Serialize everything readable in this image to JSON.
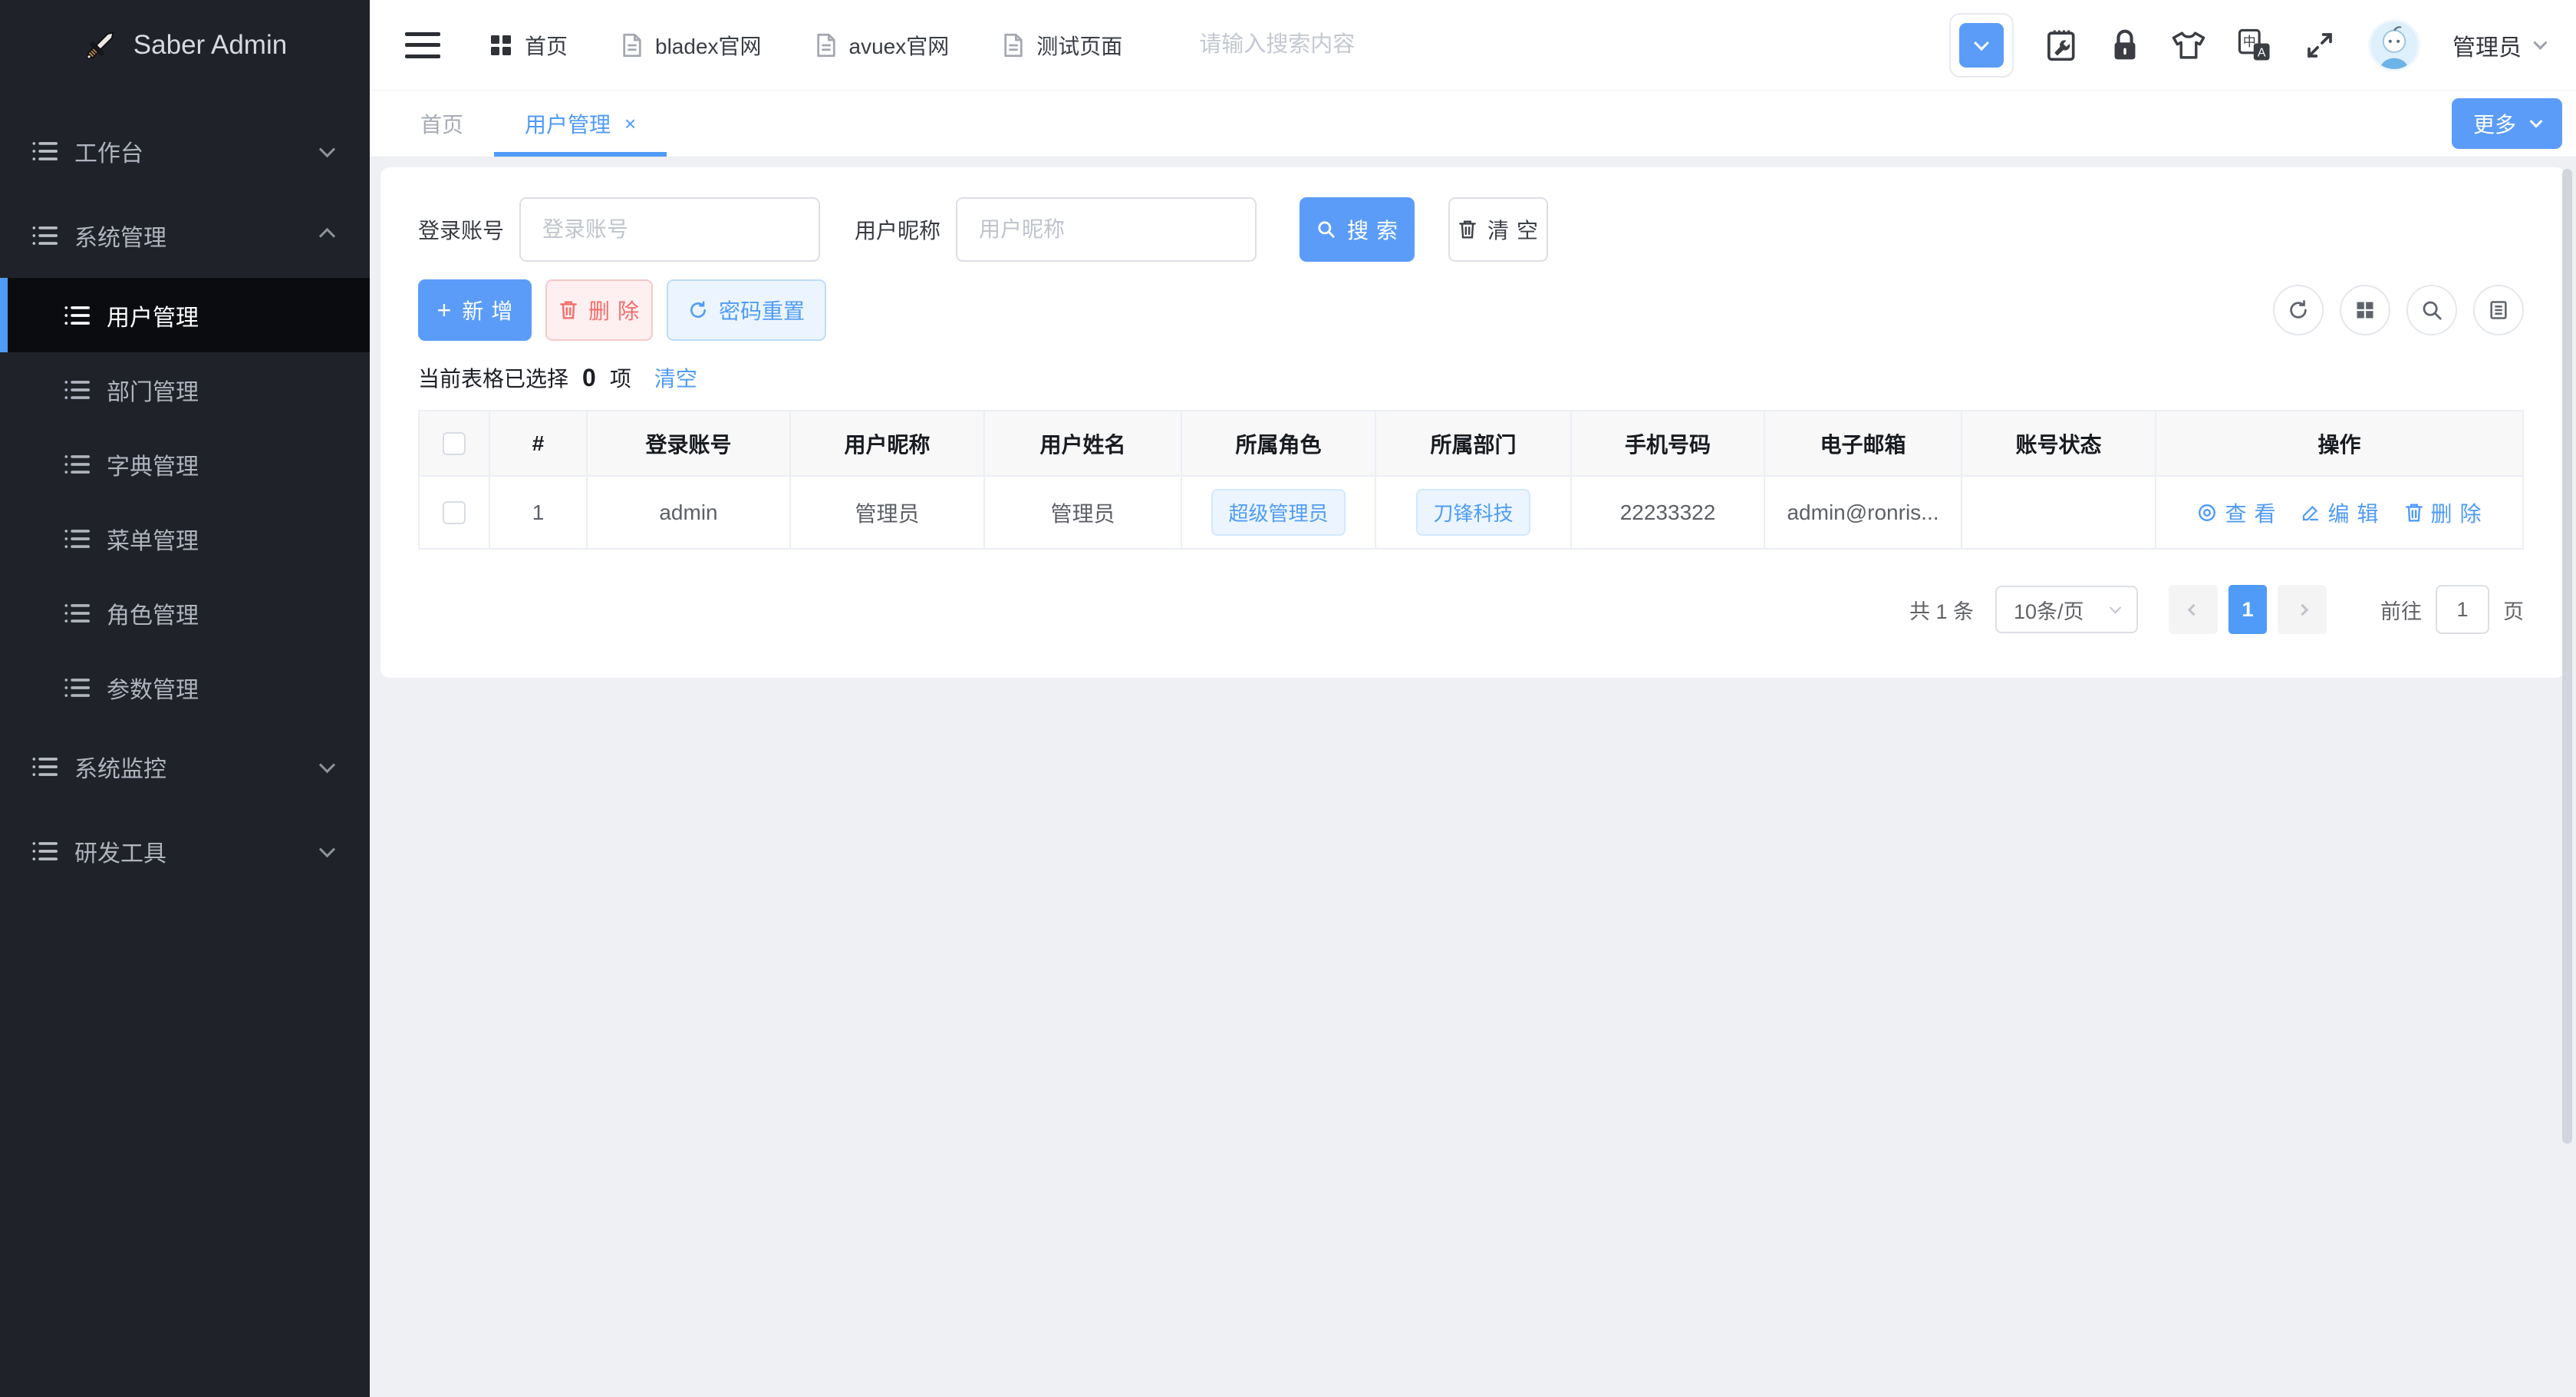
{
  "theme": {
    "accent": "#4f9bf7",
    "danger": "#f56c6c",
    "sidebar_bg": "#20222a",
    "page_bg": "#eef0f4",
    "active_item_bg": "#0a0c10"
  },
  "sidebar": {
    "logo": "Saber Admin",
    "items": [
      {
        "label": "工作台",
        "expanded": false
      },
      {
        "label": "系统管理",
        "expanded": true,
        "children": [
          {
            "label": "用户管理",
            "active": true
          },
          {
            "label": "部门管理"
          },
          {
            "label": "字典管理"
          },
          {
            "label": "菜单管理"
          },
          {
            "label": "角色管理"
          },
          {
            "label": "参数管理"
          }
        ]
      },
      {
        "label": "系统监控",
        "expanded": false
      },
      {
        "label": "研发工具",
        "expanded": false
      }
    ]
  },
  "topbar": {
    "menu": [
      {
        "label": "首页",
        "icon": "grid-icon"
      },
      {
        "label": "bladex官网",
        "icon": "document-icon"
      },
      {
        "label": "avuex官网",
        "icon": "document-icon"
      },
      {
        "label": "测试页面",
        "icon": "document-icon"
      }
    ],
    "search_placeholder": "请输入搜索内容",
    "username": "管理员"
  },
  "tabbar": {
    "tabs": [
      {
        "label": "首页",
        "active": false
      },
      {
        "label": "用户管理",
        "active": true,
        "close": "×"
      }
    ],
    "more_label": "更多"
  },
  "filters": {
    "fields": [
      {
        "label": "登录账号",
        "placeholder": "登录账号",
        "value": ""
      },
      {
        "label": "用户昵称",
        "placeholder": "用户昵称",
        "value": ""
      }
    ],
    "search_label": "搜索",
    "clear_label": "清空"
  },
  "toolbar": {
    "add_label": "新增",
    "delete_label": "删除",
    "reset_label": "密码重置"
  },
  "selection": {
    "prefix": "当前表格已选择",
    "count": "0",
    "suffix": "项",
    "clear_label": "清空"
  },
  "table": {
    "columns": [
      "#",
      "登录账号",
      "用户昵称",
      "用户姓名",
      "所属角色",
      "所属部门",
      "手机号码",
      "电子邮箱",
      "账号状态",
      "操作"
    ],
    "rows": [
      {
        "index": "1",
        "account": "admin",
        "nickname": "管理员",
        "realname": "管理员",
        "role": "超级管理员",
        "dept": "刀锋科技",
        "phone": "22233322",
        "email": "admin@ronris...",
        "status": "",
        "view": "查看",
        "edit": "编辑",
        "delete": "删除"
      }
    ]
  },
  "pagination": {
    "total": "共 1 条",
    "page_size": "10条/页",
    "page": "1",
    "goto_prefix": "前往",
    "goto_value": "1",
    "goto_suffix": "页"
  }
}
